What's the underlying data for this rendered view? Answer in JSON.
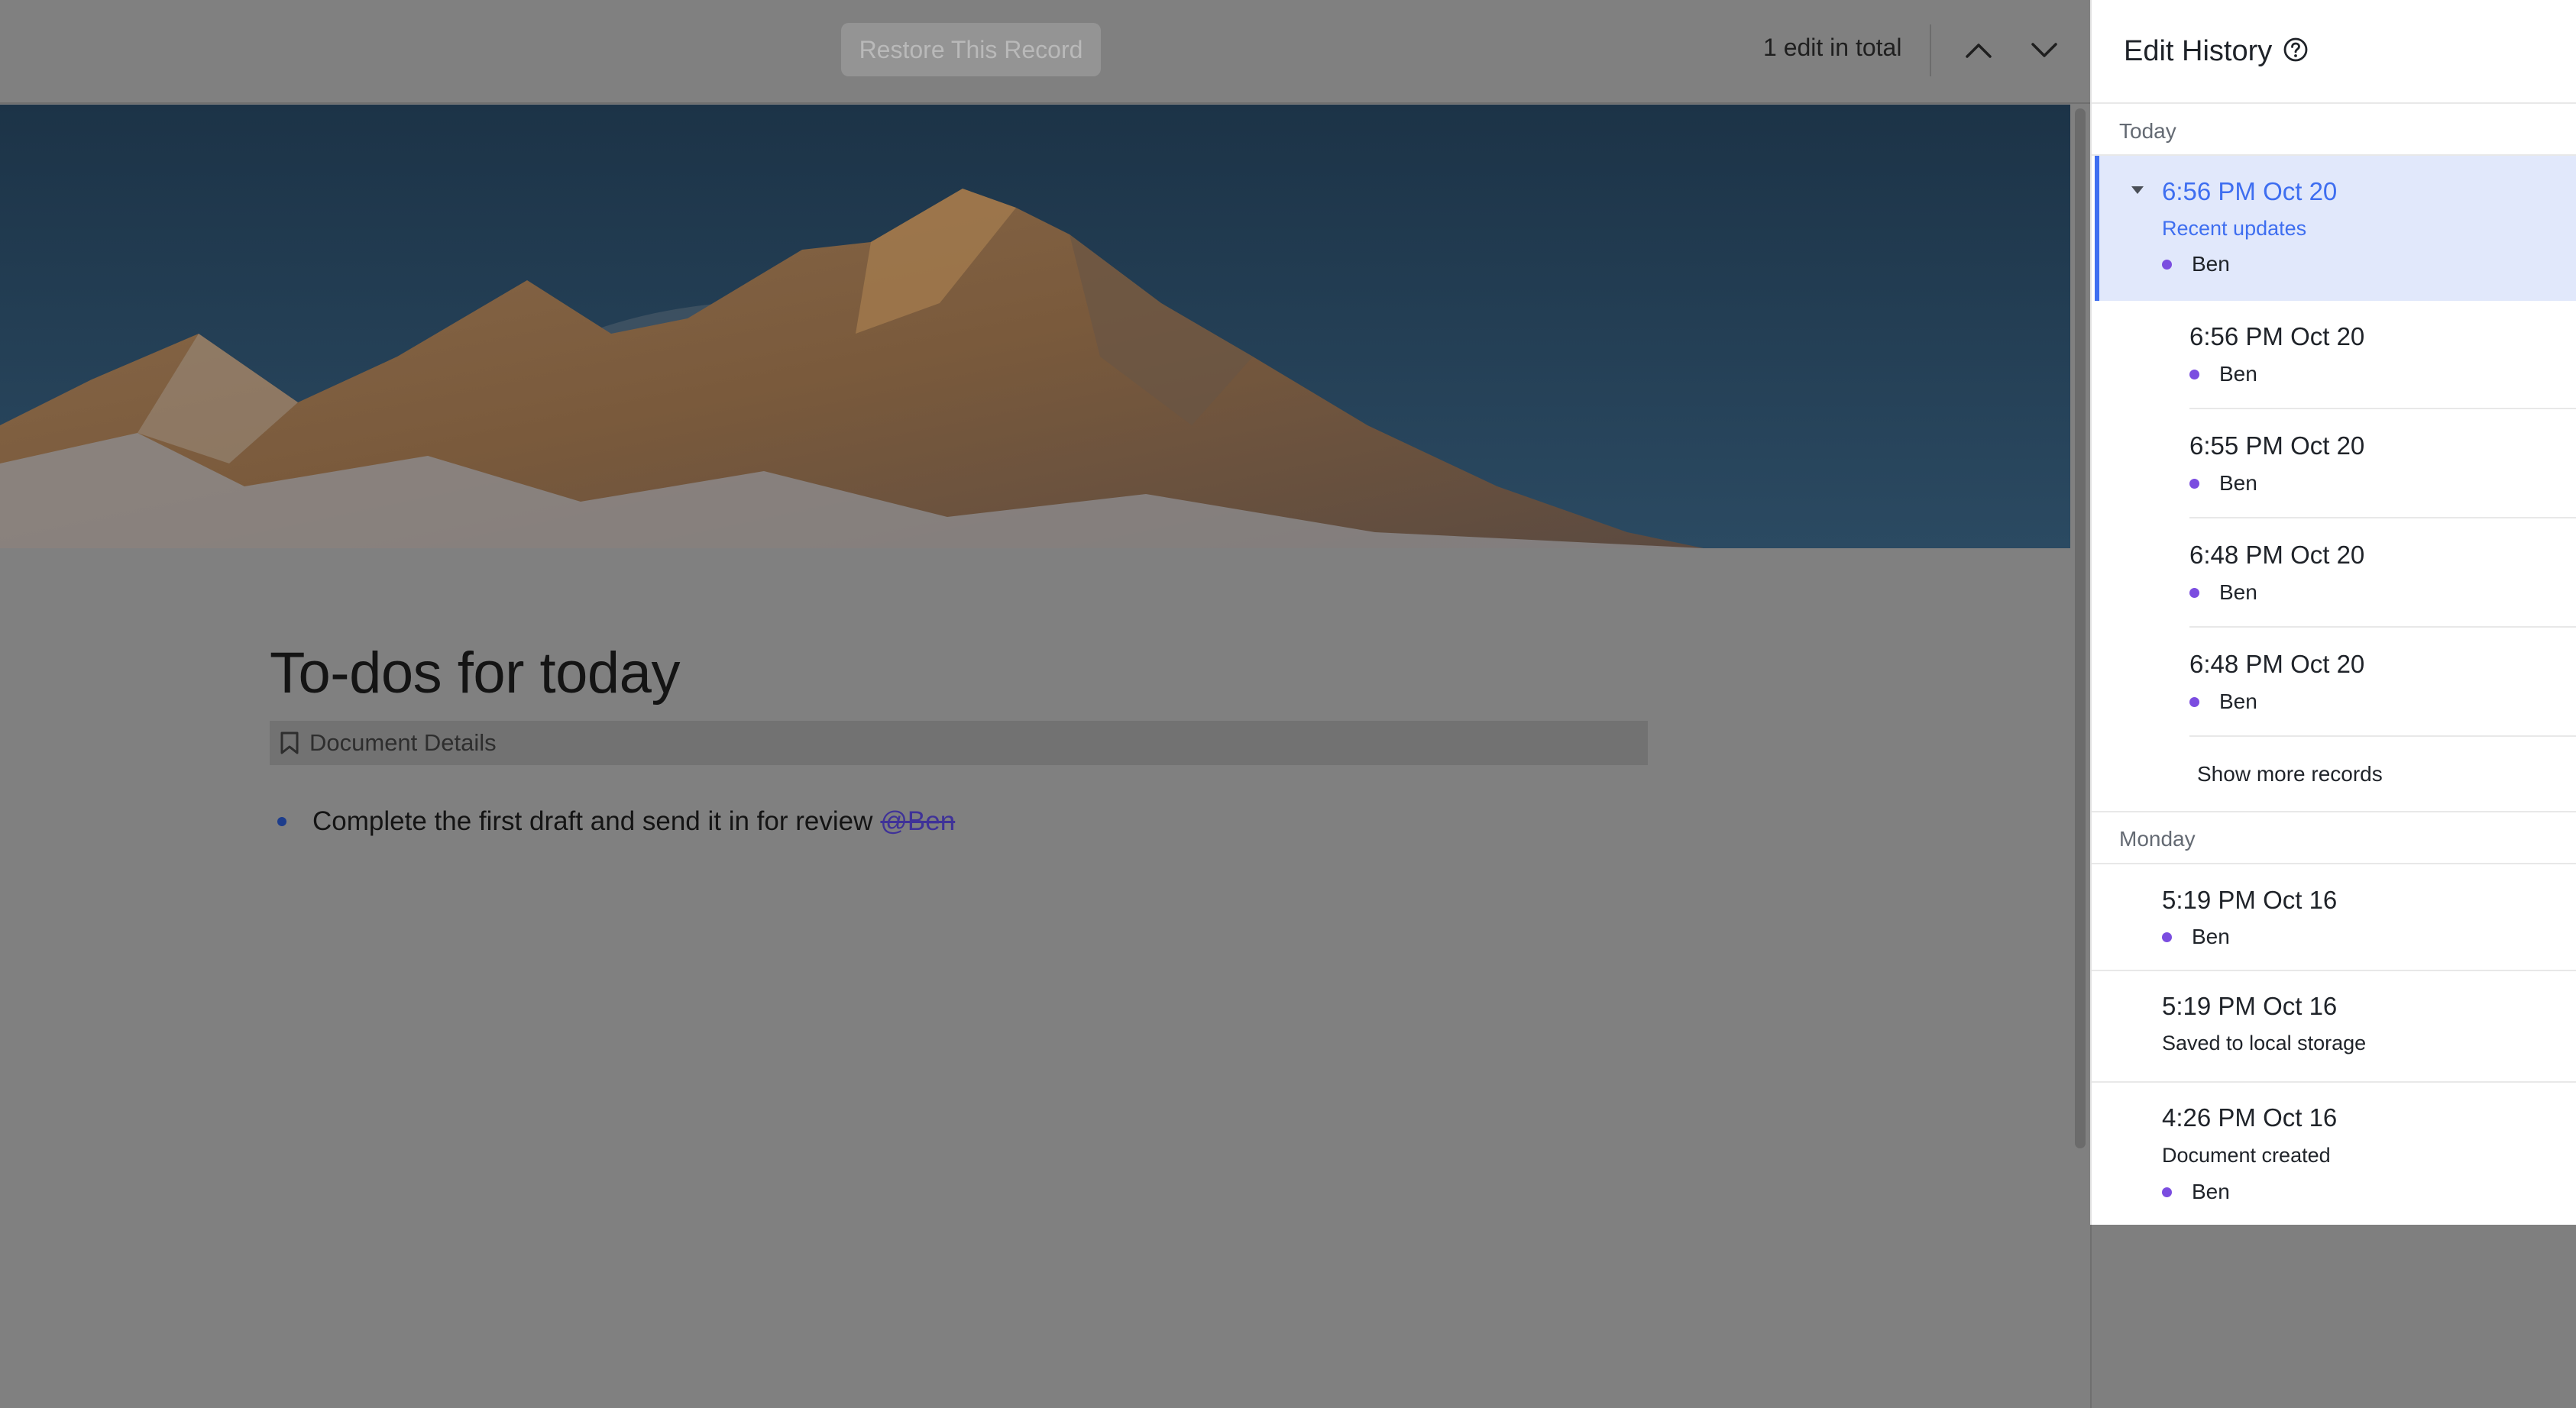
{
  "toolbar": {
    "restore_label": "Restore This Record",
    "edit_count": "1 edit in total",
    "prev_icon": "chevron-up-icon",
    "next_icon": "chevron-down-icon"
  },
  "document": {
    "title": "To-dos for today",
    "details_label": "Document Details",
    "todo_text": "Complete the first draft and send it in for review",
    "todo_mention": "@Ben"
  },
  "panel": {
    "title": "Edit History",
    "help_icon": "question-circle-icon",
    "sections": [
      {
        "label": "Today",
        "group": {
          "time": "6:56 PM Oct 20",
          "subtitle": "Recent updates",
          "author": "Ben",
          "children": [
            {
              "time": "6:56 PM Oct 20",
              "author": "Ben"
            },
            {
              "time": "6:55 PM Oct 20",
              "author": "Ben"
            },
            {
              "time": "6:48 PM Oct 20",
              "author": "Ben"
            },
            {
              "time": "6:48 PM Oct 20",
              "author": "Ben"
            }
          ],
          "show_more": "Show more records"
        }
      },
      {
        "label": "Monday",
        "records": [
          {
            "time": "5:19 PM Oct 16",
            "author": "Ben"
          },
          {
            "time": "5:19 PM Oct 16",
            "subtitle": "Saved to local storage"
          },
          {
            "time": "4:26 PM Oct 16",
            "subtitle": "Document created",
            "author": "Ben"
          }
        ]
      }
    ]
  },
  "colors": {
    "accent": "#3e6ef0",
    "selected_bg": "#e1e8fb",
    "author_dot": "#7b4de0",
    "overlay": "#808080"
  }
}
